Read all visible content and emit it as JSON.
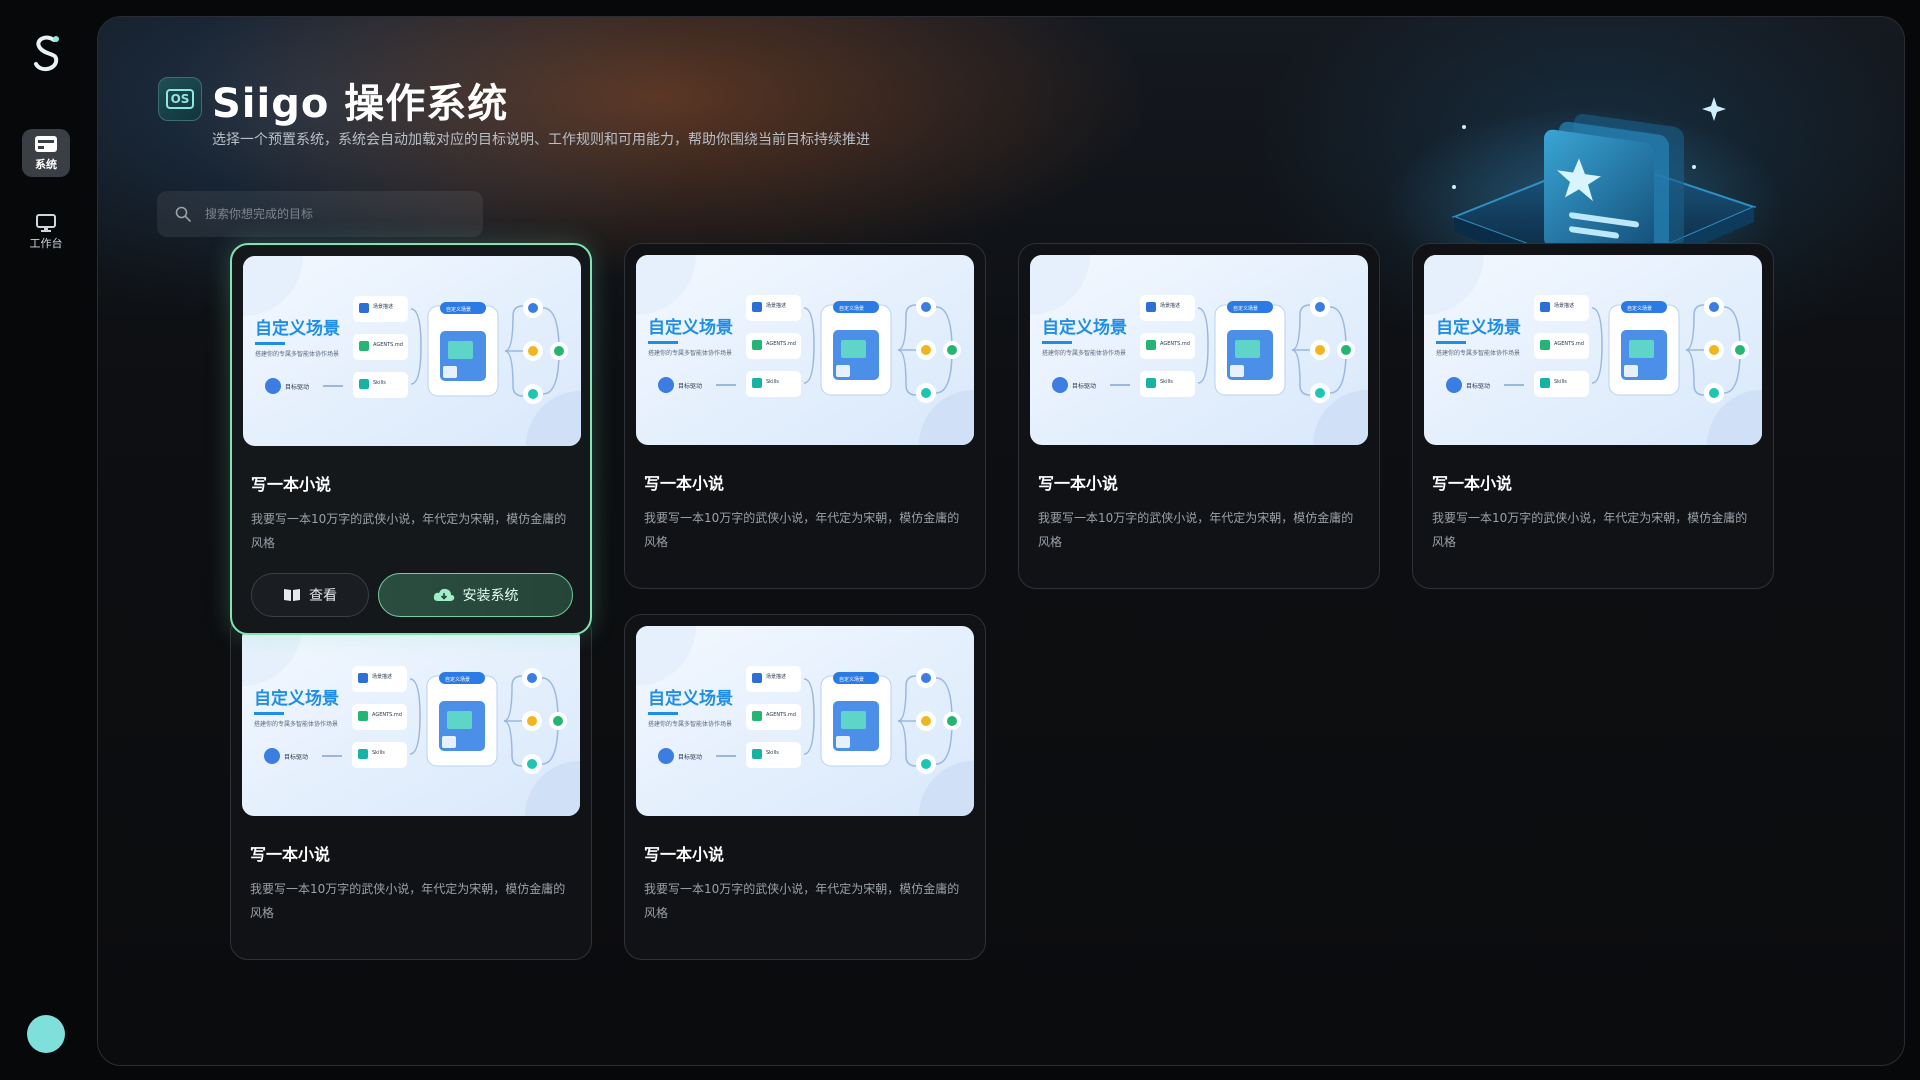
{
  "nav": {
    "items": [
      {
        "label": "系统",
        "icon": "system-icon",
        "active": true
      },
      {
        "label": "工作台",
        "icon": "monitor-icon",
        "active": false
      }
    ]
  },
  "header": {
    "os_badge": "OS",
    "title": "Siigo 操作系统",
    "subtitle": "选择一个预置系统，系统会自动加载对应的目标说明、工作规则和可用能力，帮助你围绕当前目标持续推进"
  },
  "search": {
    "placeholder": "搜索你想完成的目标"
  },
  "thumbnail": {
    "title": "自定义场景",
    "subtitle": "搭建你的专属多智能体协作场景",
    "pill": "自定义场景",
    "goal": "目标驱动",
    "items": [
      "场景描述",
      "AGENTS.md",
      "Skills"
    ]
  },
  "cards": [
    {
      "title": "写一本小说",
      "desc": "我要写一本10万字的武侠小说，年代定为宋朝，模仿金庸的风格",
      "active": true
    },
    {
      "title": "写一本小说",
      "desc": "我要写一本10万字的武侠小说，年代定为宋朝，模仿金庸的风格",
      "active": false
    },
    {
      "title": "写一本小说",
      "desc": "我要写一本10万字的武侠小说，年代定为宋朝，模仿金庸的风格",
      "active": false
    },
    {
      "title": "写一本小说",
      "desc": "我要写一本10万字的武侠小说，年代定为宋朝，模仿金庸的风格",
      "active": false
    },
    {
      "title": "写一本小说",
      "desc": "我要写一本10万字的武侠小说，年代定为宋朝，模仿金庸的风格",
      "active": false
    },
    {
      "title": "写一本小说",
      "desc": "我要写一本10万字的武侠小说，年代定为宋朝，模仿金庸的风格",
      "active": false
    }
  ],
  "card_actions": {
    "view": "查看",
    "install": "安装系统"
  },
  "colors": {
    "accent": "#7fe3b2",
    "avatar": "#7fe0db",
    "title_blue": "#1f8ee6"
  }
}
